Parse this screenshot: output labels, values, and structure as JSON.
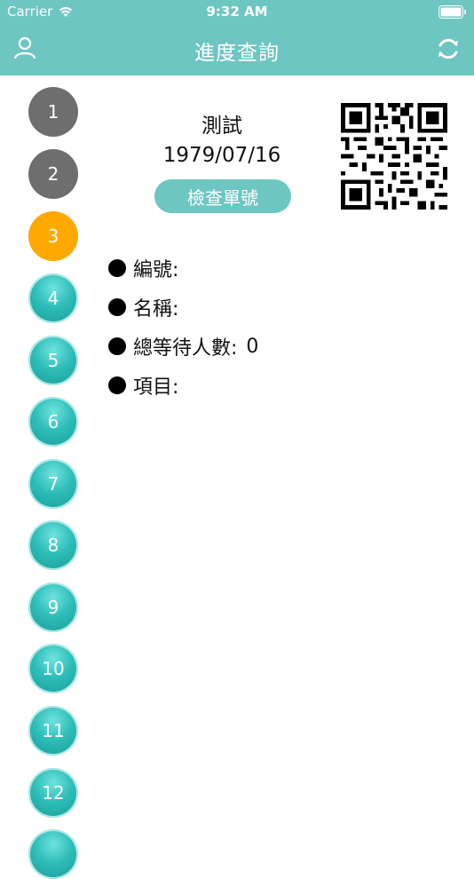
{
  "status_bar": {
    "carrier": "Carrier",
    "time": "9:32 AM"
  },
  "nav": {
    "title": "進度查詢",
    "left_icon": "user-icon",
    "right_icon": "refresh-icon"
  },
  "colors": {
    "header": "#6ec6c2",
    "step_done": "#6e6e6e",
    "step_current": "#ffa800",
    "step_pending": "#2dbdb8"
  },
  "steps": [
    {
      "label": "1",
      "state": "done"
    },
    {
      "label": "2",
      "state": "done"
    },
    {
      "label": "3",
      "state": "current"
    },
    {
      "label": "4",
      "state": "pending"
    },
    {
      "label": "5",
      "state": "pending"
    },
    {
      "label": "6",
      "state": "pending"
    },
    {
      "label": "7",
      "state": "pending"
    },
    {
      "label": "8",
      "state": "pending"
    },
    {
      "label": "9",
      "state": "pending"
    },
    {
      "label": "10",
      "state": "pending"
    },
    {
      "label": "11",
      "state": "pending"
    },
    {
      "label": "12",
      "state": "pending"
    },
    {
      "label": "",
      "state": "pending"
    }
  ],
  "profile": {
    "name": "測試",
    "birthday": "1979/07/16",
    "check_button_label": "檢查單號"
  },
  "info": [
    {
      "label": "編號:",
      "value": ""
    },
    {
      "label": "名稱:",
      "value": ""
    },
    {
      "label": "總等待人數:",
      "value": "0"
    },
    {
      "label": "項目:",
      "value": ""
    }
  ]
}
